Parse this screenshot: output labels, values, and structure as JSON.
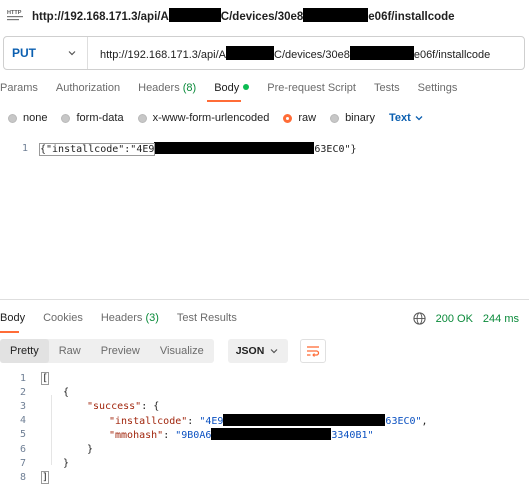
{
  "title": {
    "url_prefix": "http://192.168.171.3/api/A",
    "url_mid": "C/devices/30e8",
    "url_suffix": "e06f/installcode"
  },
  "request": {
    "method": "PUT",
    "url_prefix": "http://192.168.171.3/api/A",
    "url_mid": "C/devices/30e8",
    "url_suffix": "e06f/installcode"
  },
  "request_tabs": {
    "params": "Params",
    "authorization": "Authorization",
    "headers": "Headers",
    "headers_count": "(8)",
    "body": "Body",
    "pre_request": "Pre-request Script",
    "tests": "Tests",
    "settings": "Settings"
  },
  "body_types": {
    "none": "none",
    "form_data": "form-data",
    "urlencoded": "x-www-form-urlencoded",
    "raw": "raw",
    "binary": "binary",
    "format": "Text"
  },
  "request_body": {
    "line_number": "1",
    "prefix": "{\"installcode\":\"4E9",
    "suffix": "63EC0\"}"
  },
  "response_tabs": {
    "body": "Body",
    "cookies": "Cookies",
    "headers": "Headers",
    "headers_count": "(3)",
    "test_results": "Test Results"
  },
  "response_status": {
    "status": "200 OK",
    "time": "244 ms"
  },
  "response_toolbar": {
    "pretty": "Pretty",
    "raw": "Raw",
    "preview": "Preview",
    "visualize": "Visualize",
    "format": "JSON"
  },
  "response_lines": {
    "l1": "1",
    "l2": "2",
    "l3": "3",
    "l4": "4",
    "l5": "5",
    "l6": "6",
    "l7": "7",
    "l8": "8",
    "t1": "[",
    "t2": "{",
    "t3_key": "\"success\"",
    "t3_rest": ": {",
    "t4_key": "\"installcode\"",
    "t4_colon": ": ",
    "t4_prefix": "\"4E9",
    "t4_suffix": "63EC0\"",
    "t4_comma": ",",
    "t5_key": "\"mmohash\"",
    "t5_colon": ": ",
    "t5_prefix": "\"9B0A6",
    "t5_suffix": "3340B1\"",
    "t6": "}",
    "t7": "}",
    "t8": "]"
  },
  "colors": {
    "accent": "#ff6c37",
    "method_blue": "#0b5fb0",
    "status_green": "#0a8a3a",
    "json_key": "#a1260d",
    "json_string": "#0b51c1"
  }
}
